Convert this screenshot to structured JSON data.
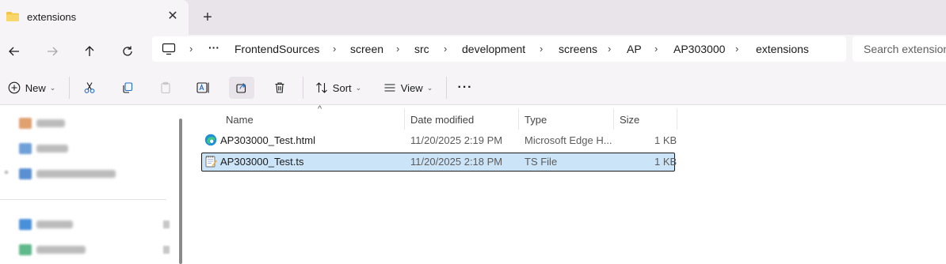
{
  "tab": {
    "title": "extensions",
    "close": "✕",
    "new": "+"
  },
  "nav": {
    "breadcrumbs": [
      "FrontendSources",
      "screen",
      "src",
      "development",
      "screens",
      "AP",
      "AP303000",
      "extensions"
    ],
    "overflow": "···",
    "search_placeholder": "Search extensions"
  },
  "toolbar": {
    "new_label": "New",
    "sort_label": "Sort",
    "view_label": "View",
    "more": "···"
  },
  "columns": {
    "name": "Name",
    "date": "Date modified",
    "type": "Type",
    "size": "Size"
  },
  "files": [
    {
      "name": "AP303000_Test.html",
      "date": "11/20/2025 2:19 PM",
      "type": "Microsoft Edge H...",
      "size": "1 KB",
      "icon": "edge-icon",
      "selected": false
    },
    {
      "name": "AP303000_Test.ts",
      "date": "11/20/2025 2:18 PM",
      "type": "TS File",
      "size": "1 KB",
      "icon": "notepad-icon",
      "selected": true
    }
  ],
  "colors": {
    "accent_selected": "#cce4f7",
    "folder_yellow": "#f4c542",
    "edge_blue": "#1f8fd8"
  }
}
